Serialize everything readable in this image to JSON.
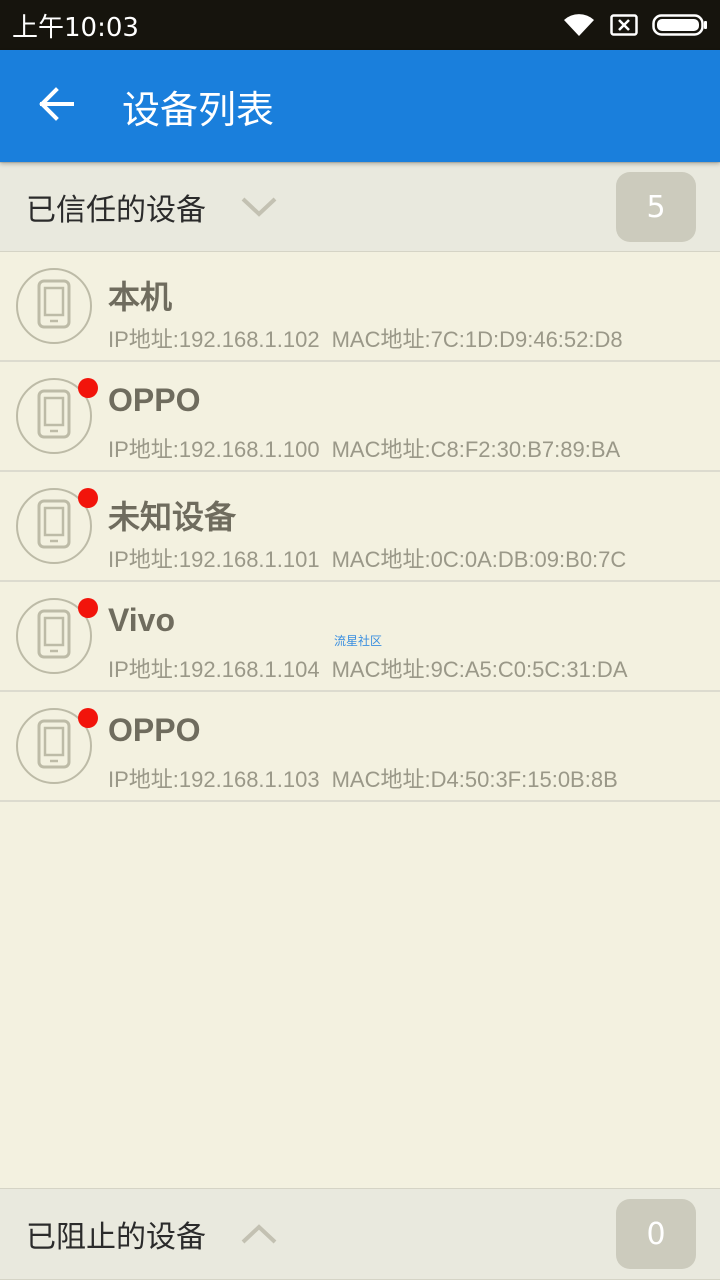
{
  "status_bar": {
    "time": "上午10:03",
    "icons": [
      "wifi-icon",
      "sim-x-icon",
      "battery-icon"
    ]
  },
  "app_bar": {
    "title": "设备列表",
    "back_icon": "arrow-left-icon",
    "color": "#1a7fdc"
  },
  "trusted_section": {
    "title": "已信任的设备",
    "count": "5",
    "chevron": "chevron-down-icon"
  },
  "devices": [
    {
      "name": "本机",
      "ip_label": "IP地址:",
      "ip": "192.168.1.102",
      "mac_label": "MAC地址:",
      "mac": "7C:1D:D9:46:52:D8",
      "new": false
    },
    {
      "name": "OPPO",
      "ip_label": "IP地址:",
      "ip": "192.168.1.100",
      "mac_label": "MAC地址:",
      "mac": "C8:F2:30:B7:89:BA",
      "new": true
    },
    {
      "name": "未知设备",
      "ip_label": "IP地址:",
      "ip": "192.168.1.101",
      "mac_label": "MAC地址:",
      "mac": "0C:0A:DB:09:B0:7C",
      "new": true
    },
    {
      "name": "Vivo",
      "ip_label": "IP地址:",
      "ip": "192.168.1.104",
      "mac_label": "MAC地址:",
      "mac": "9C:A5:C0:5C:31:DA",
      "new": true
    },
    {
      "name": "OPPO",
      "ip_label": "IP地址:",
      "ip": "192.168.1.103",
      "mac_label": "MAC地址:",
      "mac": "D4:50:3F:15:0B:8B",
      "new": true
    }
  ],
  "watermark": "流星社区",
  "blocked_section": {
    "title": "已阻止的设备",
    "count": "0",
    "chevron": "chevron-up-icon"
  },
  "colors": {
    "background": "#f3f1e0",
    "new_dot": "#f2140b",
    "count_badge": "#cccbbd"
  }
}
